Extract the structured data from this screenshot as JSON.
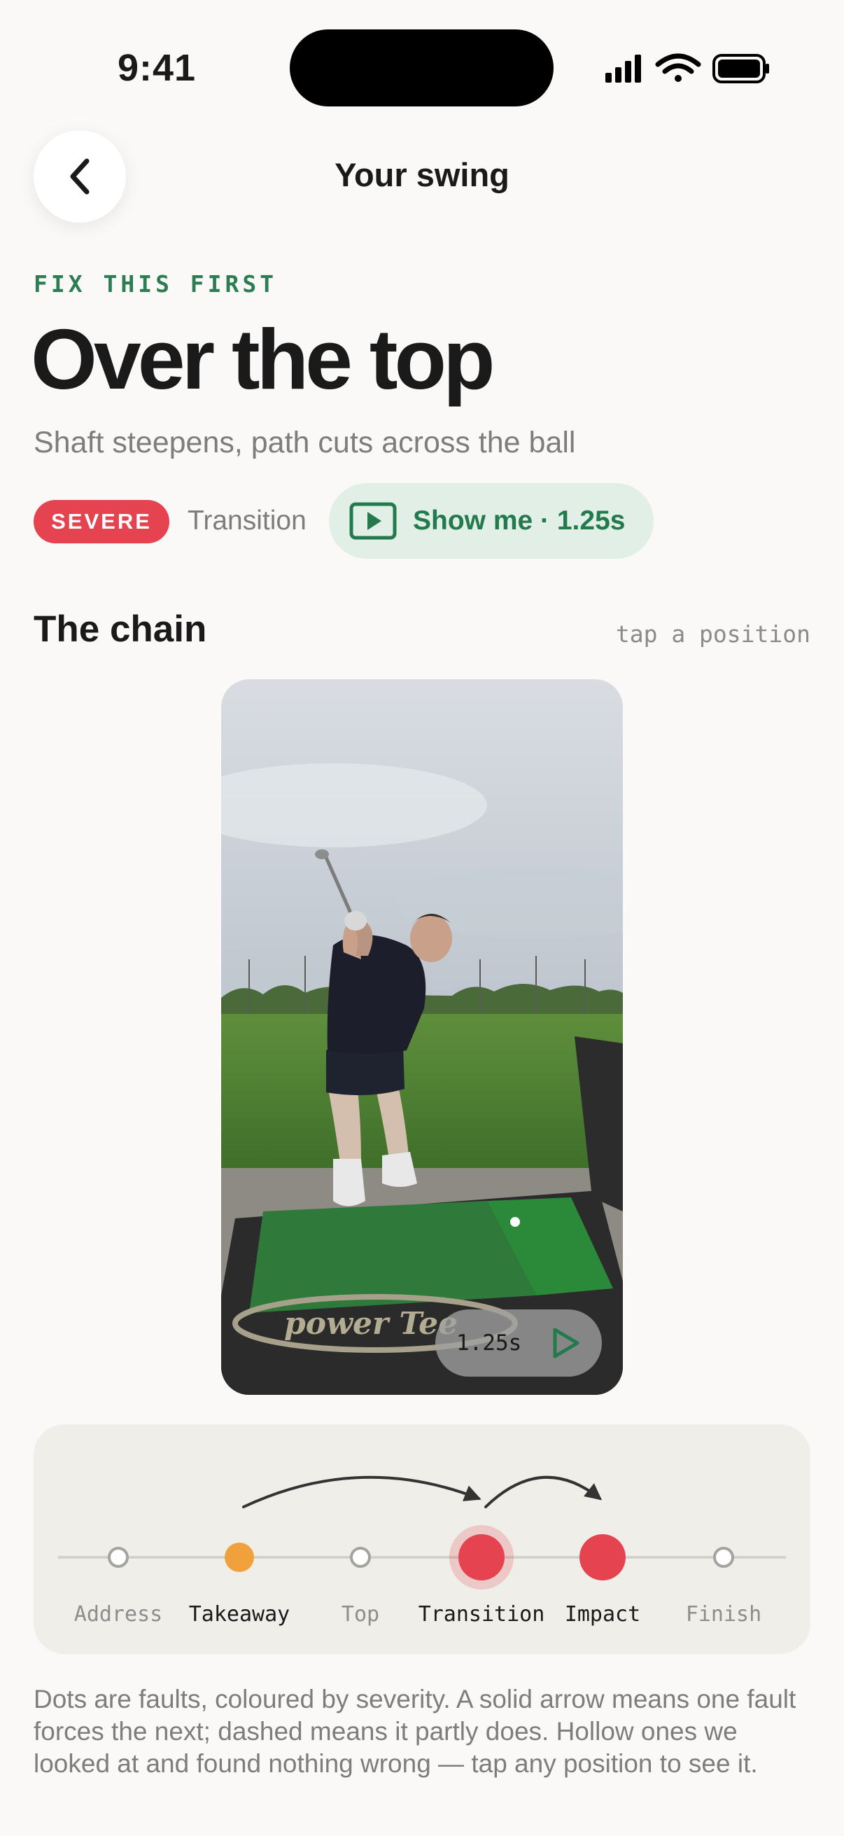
{
  "status": {
    "time": "9:41"
  },
  "header": {
    "title": "Your swing"
  },
  "fault": {
    "eyebrow": "FIX THIS FIRST",
    "title": "Over the top",
    "subtitle": "Shaft steepens, path cuts across the ball",
    "severity": "SEVERE",
    "phase": "Transition",
    "show_me": "Show me · 1.25s"
  },
  "chain": {
    "title": "The chain",
    "hint": "tap a position",
    "video_time": "1.25s",
    "positions": [
      {
        "label": "Address",
        "state": "hollow"
      },
      {
        "label": "Takeaway",
        "state": "fault-moderate"
      },
      {
        "label": "Top",
        "state": "hollow"
      },
      {
        "label": "Transition",
        "state": "fault-severe-selected"
      },
      {
        "label": "Impact",
        "state": "fault-severe"
      },
      {
        "label": "Finish",
        "state": "hollow"
      }
    ],
    "arrows": [
      {
        "from": "Takeaway",
        "to": "Transition",
        "style": "solid"
      },
      {
        "from": "Transition",
        "to": "Impact",
        "style": "solid"
      }
    ]
  },
  "colors": {
    "severe": "#e5434f",
    "moderate": "#f0a13c",
    "accent_green": "#237a4c"
  },
  "explanation": "Dots are faults, coloured by severity. A solid arrow means one fault forces the next; dashed means it partly does. Hollow ones we looked at and found nothing wrong — tap any position to see it."
}
